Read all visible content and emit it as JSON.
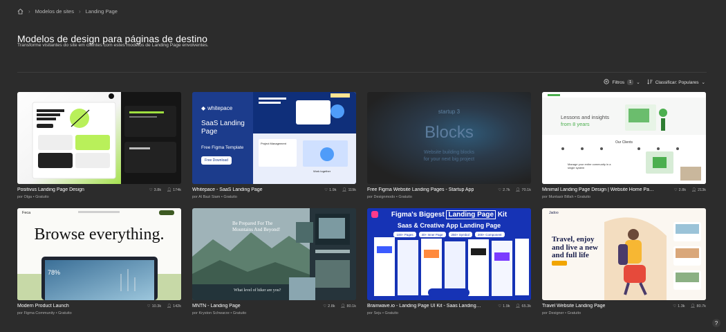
{
  "breadcrumb": {
    "items": [
      "Modelos de sites",
      "Landing Page"
    ]
  },
  "page": {
    "title": "Modelos de design para páginas de destino",
    "subtitle": "Transforme visitantes do site em clientes com estes modelos de Landing Page envolventes."
  },
  "toolbar": {
    "filters_label": "Filtros",
    "filters_count": "1",
    "sort_label": "Classificar: Populares"
  },
  "cards": [
    {
      "title": "Positivus Landing Page Design",
      "likes": "3.8k",
      "users": "174k",
      "author": "por Olga",
      "price": "Gratuito"
    },
    {
      "title": "Whitepace - SaaS Landing Page",
      "likes": "1.9k",
      "users": "119k",
      "author": "por Al Bazi Siam",
      "price": "Gratuito",
      "thumb": {
        "brand": "whitepace",
        "heading": "SaaS Landing Page",
        "sub": "Free Figma Template",
        "cta": "Free Download",
        "block1": "Project Management",
        "block2": "Work together"
      }
    },
    {
      "title": "Free Figma Website Landing Pages - Startup App",
      "likes": "2.7k",
      "users": "70.1k",
      "author": "por Designmodo",
      "price": "Gratuito",
      "thumb": {
        "kicker": "startup 3",
        "big": "Blocks",
        "line1": "Website building blocks",
        "line2": "for your next big project"
      }
    },
    {
      "title": "Minimal Landing Page Design | Website Home Page Desig...",
      "likes": "2.8k",
      "users": "213k",
      "author": "por Muntasir Billah",
      "price": "Gratuito",
      "thumb": {
        "heading1": "Lessons and insights",
        "heading2": "from 8 years",
        "section": "Our Clients",
        "foot": "Manage your entire community in a single system"
      }
    },
    {
      "title": "Modern Product Launch",
      "likes": "10.3k",
      "users": "142k",
      "author": "por Figma Community",
      "price": "Gratuito",
      "thumb": {
        "logo": "Feca",
        "headline": "Browse everything.",
        "stat": "78%"
      }
    },
    {
      "title": "MNTN - Landing Page",
      "likes": "2.8k",
      "users": "80.1k",
      "author": "por Kryston Schwarze",
      "price": "Gratuito",
      "thumb": {
        "headline1": "Be Prepared For The",
        "headline2": "Mountains And Beyond!",
        "caption": "What level of hiker are you?"
      }
    },
    {
      "title": "Brainwave.io - Landing Page UI Kit - Saas Landing Page -...",
      "likes": "1.9k",
      "users": "65.3k",
      "author": "por Seju",
      "price": "Gratuito",
      "thumb": {
        "line1a": "Figma's Biggest",
        "line1b": "Landing Page",
        "line1c": "Kit",
        "line2": "Saas & Creative App Landing Page",
        "pills": [
          "100+ Pages",
          "40+ Inner Page",
          "250+ Symbol",
          "200+ Component"
        ]
      }
    },
    {
      "title": "Travel Website Landing Page",
      "likes": "1.3k",
      "users": "80.7k",
      "author": "por Designer",
      "price": "Gratuito",
      "thumb": {
        "logo": "Jadoo",
        "headline1": "Travel, enjoy",
        "headline2": "and live a new",
        "headline3": "and full life"
      }
    }
  ],
  "colors": {
    "background": "#2c2c2c",
    "text": "#ffffff",
    "muted": "#a9a9a9",
    "accent_green": "#a6e84a",
    "brainwave_blue": "#1a36b8"
  },
  "help": {
    "label": "?"
  }
}
